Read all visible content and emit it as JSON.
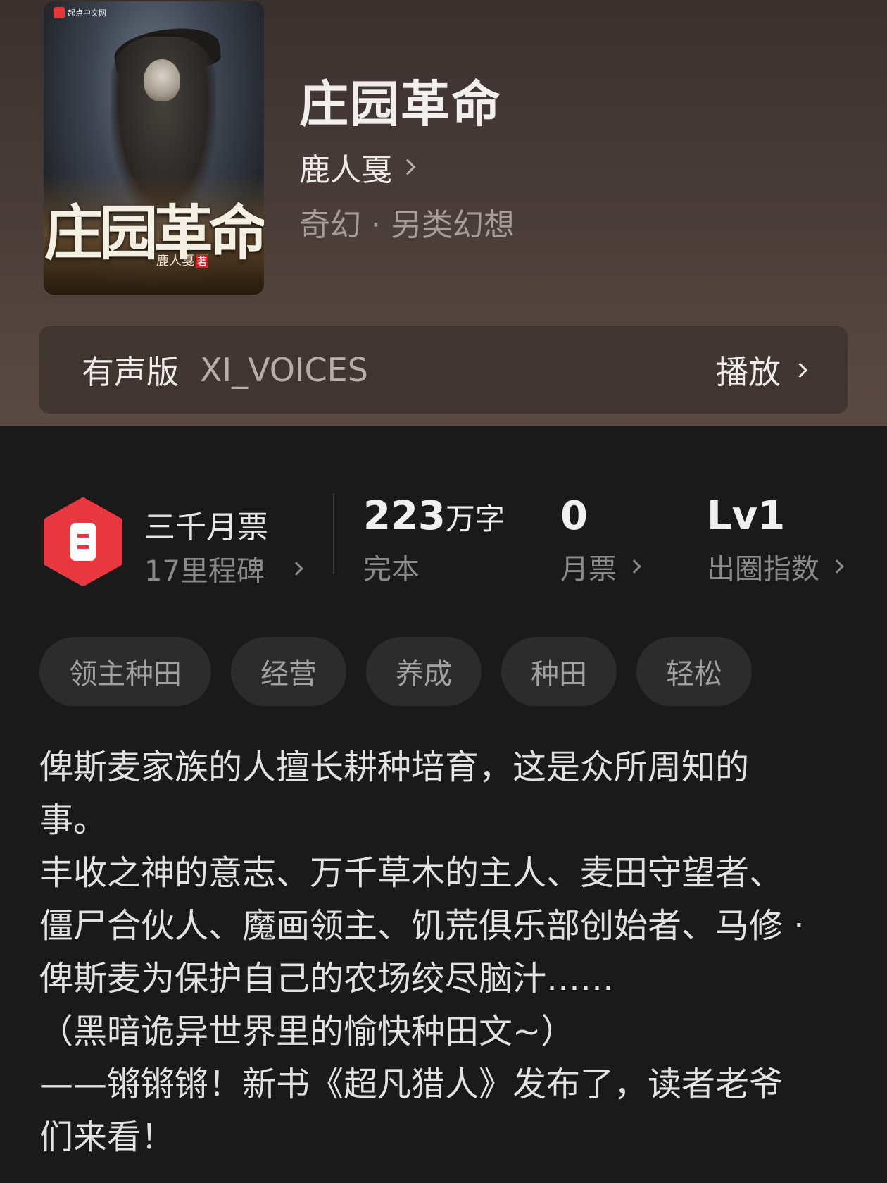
{
  "cover": {
    "publisher": "起点中文网",
    "title": "庄园革命",
    "author": "鹿人戛",
    "author_suffix": "著"
  },
  "book": {
    "title": "庄园革命",
    "author": "鹿人戛",
    "genre": "奇幻 · 另类幻想"
  },
  "audio": {
    "label": "有声版",
    "voice": "XI_VOICES",
    "play": "播放"
  },
  "milestone": {
    "title": "三千月票",
    "subtitle": "17里程碑",
    "icon": "ticket-badge-icon",
    "color": "#e8373f"
  },
  "stats": {
    "words_value": "223",
    "words_unit": "万字",
    "status": "完本",
    "tickets_value": "0",
    "tickets_label": "月票",
    "level_value": "Lv1",
    "level_label": "出圈指数"
  },
  "tags": [
    "领主种田",
    "经营",
    "养成",
    "种田",
    "轻松"
  ],
  "description": [
    "俾斯麦家族的人擅长耕种培育，这是众所周知的",
    "事。",
    "丰收之神的意志、万千草木的主人、麦田守望者、",
    "僵尸合伙人、魔画领主、饥荒俱乐部创始者、马修 ·",
    "俾斯麦为保护自己的农场绞尽脑汁……",
    "（黑暗诡异世界里的愉快种田文~）",
    "——锵锵锵！新书《超凡猎人》发布了，读者老爷",
    "们来看！"
  ]
}
